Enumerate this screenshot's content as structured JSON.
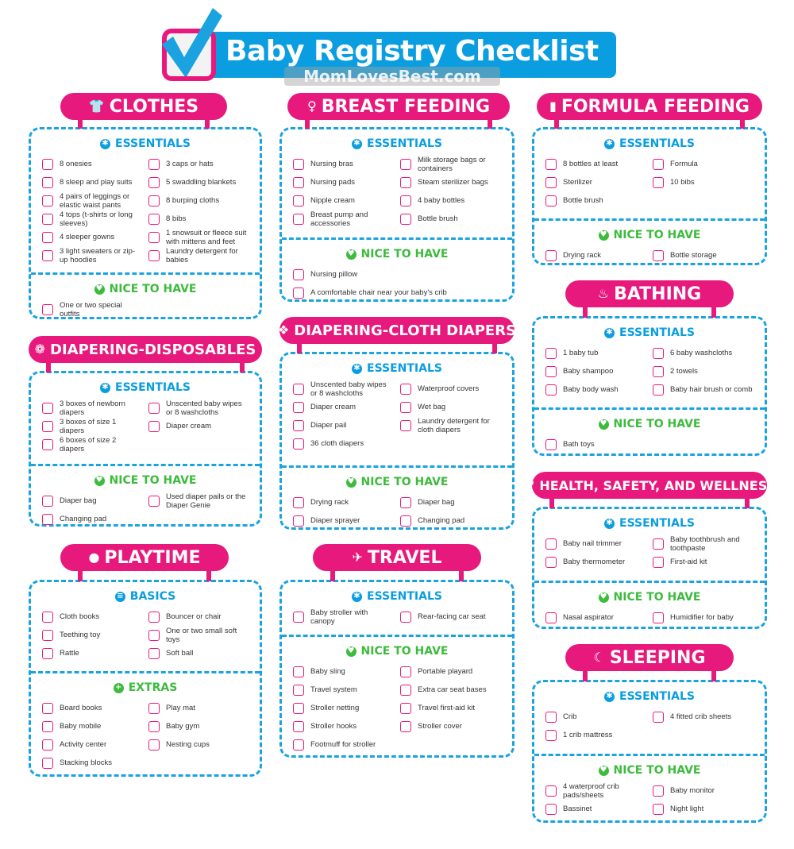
{
  "header": {
    "title": "Baby Registry Checklist",
    "watermark": "MomLovesBest.com",
    "logo_icon": "checkbox-check-icon"
  },
  "colors": {
    "pink": "#e8197c",
    "blue": "#0a9ee0",
    "green": "#3dbb3d"
  },
  "sections": [
    {
      "id": "clothes",
      "title": "CLOTHES",
      "icon": "shirt-icon",
      "groups": [
        {
          "title": "ESSENTIALS",
          "icon": "asterisk-icon",
          "color": "blue",
          "left": [
            "8 onesies",
            "8 sleep and play suits",
            "4 pairs of leggings or elastic waist pants",
            "4 tops (t-shirts or long sleeves)",
            "4 sleeper gowns",
            "3 light sweaters or zip-up hoodies"
          ],
          "right": [
            "3 caps or hats",
            "5 swaddling blankets",
            "8 burping cloths",
            "8 bibs",
            "1 snowsuit or fleece suit with mittens and feet",
            "Laundry detergent for babies"
          ]
        },
        {
          "title": "NICE TO HAVE",
          "icon": "heart-icon",
          "color": "green",
          "left": [
            "One or two special outfits"
          ],
          "right": []
        }
      ]
    },
    {
      "id": "breast-feeding",
      "title": "BREAST FEEDING",
      "icon": "nursing-mother-icon",
      "groups": [
        {
          "title": "ESSENTIALS",
          "icon": "asterisk-icon",
          "color": "blue",
          "left": [
            "Nursing bras",
            "Nursing pads",
            "Nipple cream",
            "Breast pump and accessories"
          ],
          "right": [
            "Milk storage bags or containers",
            "Steam sterilizer bags",
            "4 baby bottles",
            "Bottle brush"
          ]
        },
        {
          "title": "NICE TO HAVE",
          "icon": "heart-icon",
          "color": "green",
          "full": [
            "Nursing pillow",
            "A comfortable chair near your baby's crib"
          ]
        }
      ]
    },
    {
      "id": "formula-feeding",
      "title": "FORMULA FEEDING",
      "icon": "baby-bottle-icon",
      "groups": [
        {
          "title": "ESSENTIALS",
          "icon": "asterisk-icon",
          "color": "blue",
          "left": [
            "8 bottles at least",
            "Sterilizer",
            "Bottle brush"
          ],
          "right": [
            "Formula",
            "10 bibs"
          ]
        },
        {
          "title": "NICE TO HAVE",
          "icon": "heart-icon",
          "color": "green",
          "left": [
            "Drying rack"
          ],
          "right": [
            "Bottle storage"
          ]
        }
      ]
    },
    {
      "id": "bathing",
      "title": "BATHING",
      "icon": "bathtub-icon",
      "groups": [
        {
          "title": "ESSENTIALS",
          "icon": "asterisk-icon",
          "color": "blue",
          "left": [
            "1 baby tub",
            "Baby shampoo",
            "Baby body wash"
          ],
          "right": [
            "6 baby washcloths",
            "2 towels",
            "Baby hair brush or comb"
          ]
        },
        {
          "title": "NICE TO HAVE",
          "icon": "heart-icon",
          "color": "green",
          "left": [
            "Bath toys"
          ],
          "right": []
        }
      ]
    },
    {
      "id": "diapering-disposables",
      "title": "DIAPERING-DISPOSABLES",
      "icon": "diaper-icon",
      "groups": [
        {
          "title": "ESSENTIALS",
          "icon": "asterisk-icon",
          "color": "blue",
          "left": [
            "3 boxes of newborn diapers",
            "3 boxes of size 1 diapers",
            "6 boxes of size 2 diapers"
          ],
          "right": [
            "Unscented baby wipes or 8 washcloths",
            "Diaper cream"
          ]
        },
        {
          "title": "NICE TO HAVE",
          "icon": "heart-icon",
          "color": "green",
          "left": [
            "Diaper bag",
            "Changing pad"
          ],
          "right": [
            "Used diaper pails or the Diaper Genie"
          ]
        }
      ]
    },
    {
      "id": "diapering-cloth",
      "title": "DIAPERING-CLOTH DIAPERS",
      "icon": "cloth-diaper-icon",
      "groups": [
        {
          "title": "ESSENTIALS",
          "icon": "asterisk-icon",
          "color": "blue",
          "left": [
            "Unscented baby wipes or 8 washcloths",
            "Diaper cream",
            "Diaper pail",
            "36 cloth diapers"
          ],
          "right": [
            "Waterproof covers",
            "Wet bag",
            "Laundry detergent for cloth diapers"
          ]
        },
        {
          "title": "NICE TO HAVE",
          "icon": "heart-icon",
          "color": "green",
          "left": [
            "Drying rack",
            "Diaper sprayer"
          ],
          "right": [
            "Diaper bag",
            "Changing pad"
          ]
        }
      ]
    },
    {
      "id": "health",
      "title": "HEALTH, SAFETY, AND WELLNESS",
      "icon": "heart-plus-icon",
      "groups": [
        {
          "title": "ESSENTIALS",
          "icon": "asterisk-icon",
          "color": "blue",
          "left": [
            "Baby nail trimmer",
            "Baby thermometer"
          ],
          "right": [
            "Baby toothbrush and toothpaste",
            "First-aid kit"
          ]
        },
        {
          "title": "NICE TO HAVE",
          "icon": "heart-icon",
          "color": "green",
          "left": [
            "Nasal aspirator"
          ],
          "right": [
            "Humidifier for baby"
          ]
        }
      ]
    },
    {
      "id": "playtime",
      "title": "PLAYTIME",
      "icon": "ball-icon",
      "groups": [
        {
          "title": "BASICS",
          "icon": "list-icon",
          "color": "blue",
          "left": [
            "Cloth books",
            "Teething toy",
            "Rattle"
          ],
          "right": [
            "Bouncer or chair",
            "One or two small soft toys",
            "Soft ball"
          ]
        },
        {
          "title": "EXTRAS",
          "icon": "plus-icon",
          "color": "green",
          "left": [
            "Board books",
            "Baby mobile",
            "Activity center",
            "Stacking blocks"
          ],
          "right": [
            "Play mat",
            "Baby gym",
            "Nesting cups"
          ]
        }
      ]
    },
    {
      "id": "travel",
      "title": "TRAVEL",
      "icon": "airplane-icon",
      "groups": [
        {
          "title": "ESSENTIALS",
          "icon": "asterisk-icon",
          "color": "blue",
          "left": [
            "Baby stroller with canopy"
          ],
          "right": [
            "Rear-facing car seat"
          ]
        },
        {
          "title": "NICE TO HAVE",
          "icon": "heart-icon",
          "color": "green",
          "left": [
            "Baby sling",
            "Travel system",
            "Stroller netting",
            "Stroller hooks",
            "Footmuff for stroller"
          ],
          "right": [
            "Portable playard",
            "Extra car seat bases",
            "Travel first-aid kit",
            "Stroller cover"
          ]
        }
      ]
    },
    {
      "id": "sleeping",
      "title": "SLEEPING",
      "icon": "moon-icon",
      "groups": [
        {
          "title": "ESSENTIALS",
          "icon": "asterisk-icon",
          "color": "blue",
          "left": [
            "Crib",
            "1 crib mattress"
          ],
          "right": [
            "4 fitted crib sheets"
          ]
        },
        {
          "title": "NICE TO HAVE",
          "icon": "heart-icon",
          "color": "green",
          "left": [
            "4 waterproof crib pads/sheets",
            "Bassinet"
          ],
          "right": [
            "Baby monitor",
            "Night light"
          ]
        }
      ]
    }
  ]
}
